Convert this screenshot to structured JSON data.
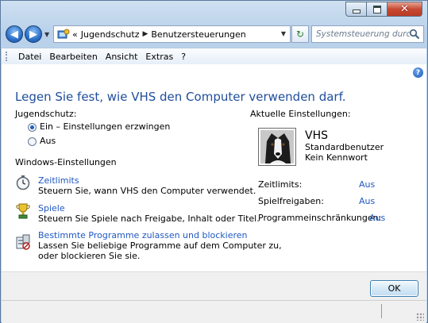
{
  "window": {
    "caption_buttons": [
      "minimize-icon",
      "maximize-icon",
      "close-icon"
    ]
  },
  "address_bar": {
    "prefix": "«",
    "crumbs": [
      "Jugendschutz",
      "Benutzersteuerungen"
    ],
    "separator": "▶"
  },
  "search": {
    "placeholder": "Systemsteuerung durchs..."
  },
  "menu": [
    "Datei",
    "Bearbeiten",
    "Ansicht",
    "Extras",
    "?"
  ],
  "main": {
    "title": "Legen Sie fest, wie VHS den Computer verwenden darf.",
    "parental_label": "Jugendschutz:",
    "options": [
      {
        "label": "Ein – Einstellungen erzwingen",
        "selected": true
      },
      {
        "label": "Aus",
        "selected": false
      }
    ],
    "windows_settings_label": "Windows-Einstellungen",
    "features": [
      {
        "title": "Zeitlimits",
        "desc": "Steuern Sie, wann VHS den Computer verwendet.",
        "icon": "clock-icon"
      },
      {
        "title": "Spiele",
        "desc": "Steuern Sie Spiele nach Freigabe, Inhalt oder Titel.",
        "icon": "trophy-icon"
      },
      {
        "title": "Bestimmte Programme zulassen und blockieren",
        "desc_lines": [
          "Lassen Sie beliebige Programme auf dem Computer zu,",
          "oder blockieren Sie sie."
        ],
        "icon": "program-block-icon"
      }
    ]
  },
  "current": {
    "label": "Aktuelle Einstellungen:",
    "user_name": "VHS",
    "user_type": "Standardbenutzer",
    "password": "Kein Kennwort",
    "rows": [
      {
        "key": "Zeitlimits:",
        "value": "Aus"
      },
      {
        "key": "Spielfreigaben:",
        "value": "Aus"
      },
      {
        "key": "Programmeinschränkungen:",
        "value": "Aus"
      }
    ]
  },
  "buttons": {
    "ok": "OK"
  },
  "colors": {
    "title_blue": "#1f4e9c",
    "link_blue": "#1f58c2"
  }
}
